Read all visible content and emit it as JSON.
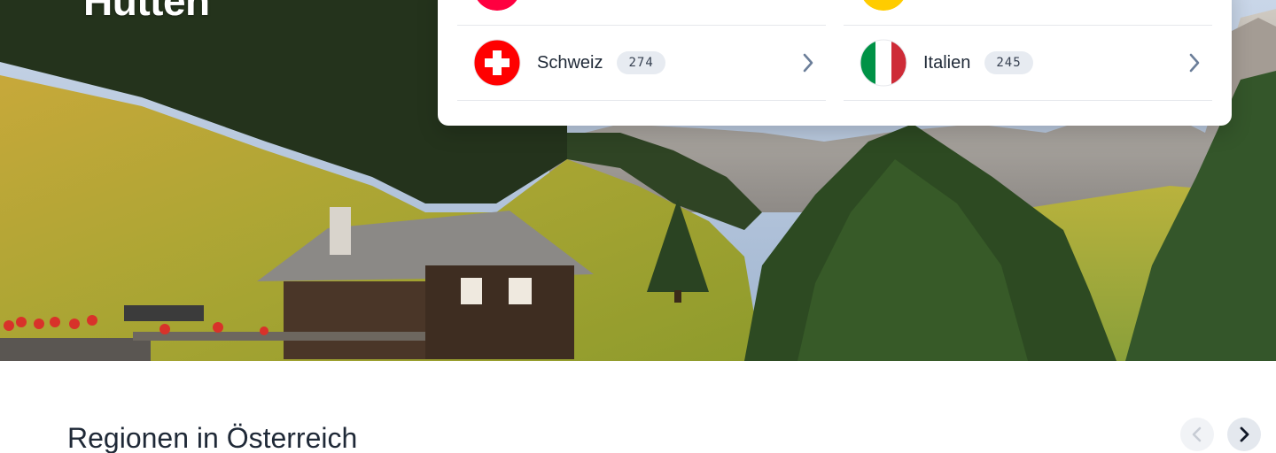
{
  "hero": {
    "title": "Hütten"
  },
  "countries": [
    {
      "name": "",
      "count": "",
      "flag": "at-flag-icon",
      "color": "#ff0040"
    },
    {
      "name": "",
      "count": "",
      "flag": "de-flag-icon",
      "color": "#ffcc00"
    },
    {
      "name": "Schweiz",
      "count": "274",
      "flag": "ch-flag-icon",
      "color": "#ff0000"
    },
    {
      "name": "Italien",
      "count": "245",
      "flag": "it-flag-icon",
      "color": "#009246"
    }
  ],
  "regions": {
    "title": "Regionen in Österreich",
    "prev_icon": "chevron-left-icon",
    "next_icon": "chevron-right-icon"
  },
  "colors": {
    "chevron": "#6b7e99",
    "badge_bg": "#e7ebf1",
    "text": "#1f2937"
  }
}
